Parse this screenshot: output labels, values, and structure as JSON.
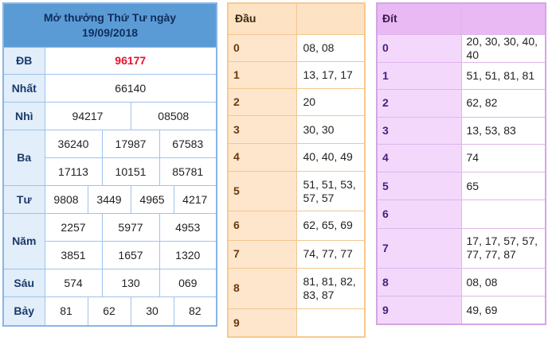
{
  "results": {
    "title_line1": "Mở thưởng Thứ Tư ngày",
    "title_line2": "19/09/2018",
    "db_label": "ĐB",
    "db": "96177",
    "nhat_label": "Nhất",
    "nhat": "66140",
    "nhi_label": "Nhì",
    "nhi": [
      "94217",
      "08508"
    ],
    "ba_label": "Ba",
    "ba": [
      "36240",
      "17987",
      "67583",
      "17113",
      "10151",
      "85781"
    ],
    "tu_label": "Tư",
    "tu": [
      "9808",
      "3449",
      "4965",
      "4217"
    ],
    "nam_label": "Năm",
    "nam": [
      "2257",
      "5977",
      "4953",
      "3851",
      "1657",
      "1320"
    ],
    "sau_label": "Sáu",
    "sau": [
      "574",
      "130",
      "069"
    ],
    "bay_label": "Bảy",
    "bay": [
      "81",
      "62",
      "30",
      "82"
    ]
  },
  "dau": {
    "header": "Đầu",
    "rows": [
      {
        "digit": "0",
        "values": "08, 08"
      },
      {
        "digit": "1",
        "values": "13, 17, 17"
      },
      {
        "digit": "2",
        "values": "20"
      },
      {
        "digit": "3",
        "values": "30, 30"
      },
      {
        "digit": "4",
        "values": "40, 40, 49"
      },
      {
        "digit": "5",
        "values": "51, 51, 53, 57, 57"
      },
      {
        "digit": "6",
        "values": "62, 65, 69"
      },
      {
        "digit": "7",
        "values": "74, 77, 77"
      },
      {
        "digit": "8",
        "values": "81, 81, 82, 83, 87"
      },
      {
        "digit": "9",
        "values": ""
      }
    ]
  },
  "dit": {
    "header": "Đít",
    "rows": [
      {
        "digit": "0",
        "values": "20, 30, 30, 40, 40"
      },
      {
        "digit": "1",
        "values": "51, 51, 81, 81"
      },
      {
        "digit": "2",
        "values": "62, 82"
      },
      {
        "digit": "3",
        "values": "13, 53, 83"
      },
      {
        "digit": "4",
        "values": "74"
      },
      {
        "digit": "5",
        "values": "65"
      },
      {
        "digit": "6",
        "values": ""
      },
      {
        "digit": "7",
        "values": "17, 17, 57, 57, 77, 77, 87"
      },
      {
        "digit": "8",
        "values": "08, 08"
      },
      {
        "digit": "9",
        "values": "49, 69"
      }
    ]
  },
  "colors": {
    "header_blue": "#5b9bd5",
    "db_red": "#e8112d",
    "dau_orange": "#fde3c4",
    "dit_purple": "#e9b9f3"
  }
}
